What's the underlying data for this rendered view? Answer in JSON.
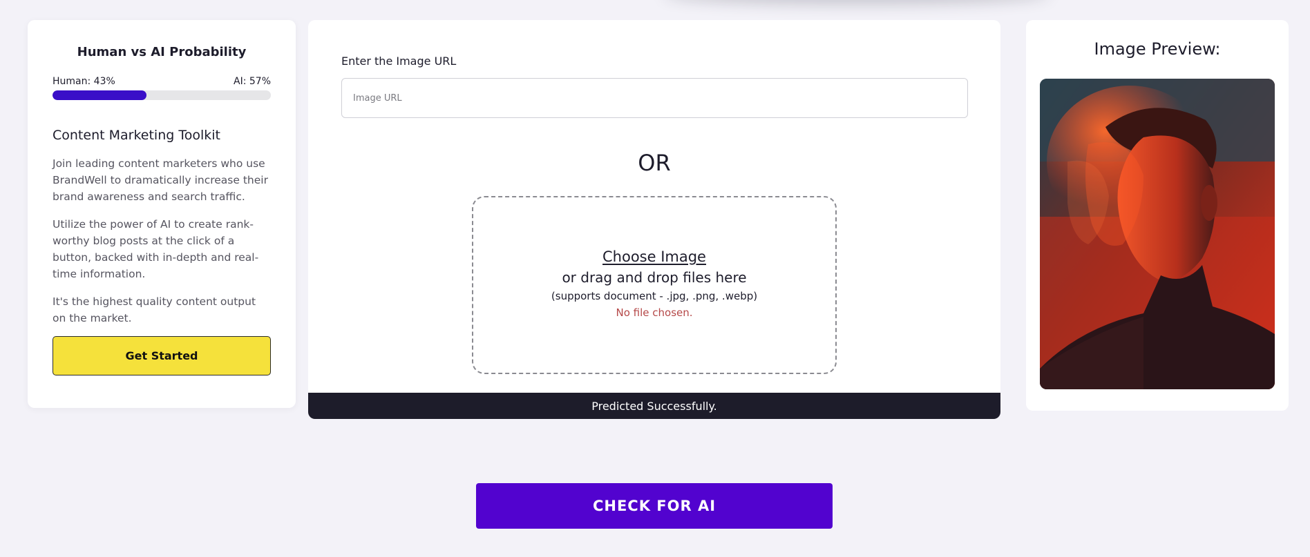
{
  "probability": {
    "title": "Human vs AI Probability",
    "human_label": "Human: 43%",
    "ai_label": "AI: 57%",
    "human_fraction": 0.43,
    "bar_color": "#3a0fc8"
  },
  "promo": {
    "title": "Content Marketing Toolkit",
    "paragraphs": [
      "Join leading content marketers who use BrandWell to dramatically increase their brand awareness and search traffic.",
      "Utilize the power of AI to create rank-worthy blog posts at the click of a button, backed with in-depth and real-time information.",
      "It's the highest quality content output on the market."
    ],
    "cta_label": "Get Started",
    "cta_color": "#f5e13b"
  },
  "upload": {
    "url_label": "Enter the Image URL",
    "url_placeholder": "Image URL",
    "url_value": "",
    "or_text": "OR",
    "choose_label": "Choose Image",
    "drag_text": "or drag and drop files here",
    "supports_text": "(supports document - .jpg, .png, .webp)",
    "file_status": "No file chosen."
  },
  "status": {
    "message": "Predicted Successfully."
  },
  "preview": {
    "title": "Image Preview:"
  },
  "actions": {
    "check_label": "CHECK FOR AI",
    "check_color": "#5203cf"
  }
}
